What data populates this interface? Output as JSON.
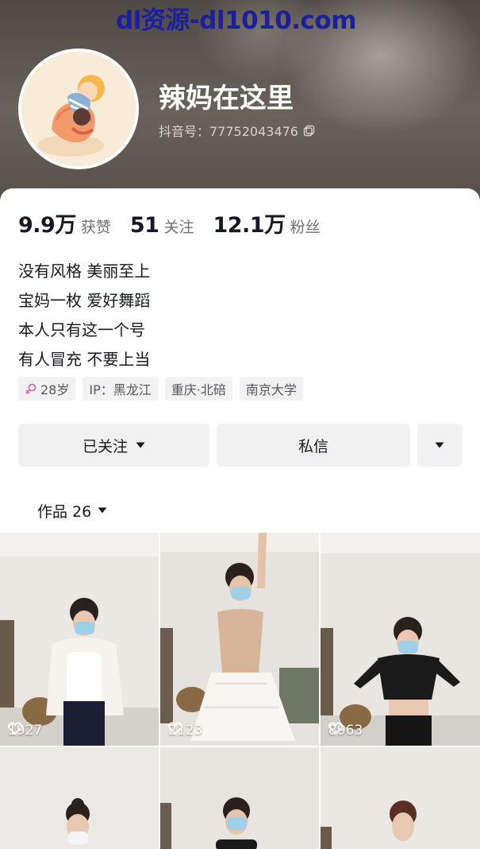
{
  "watermark": "dl资源-dl1010.com",
  "profile": {
    "nickname": "辣妈在这里",
    "douyin_id_label": "抖音号：77752043476",
    "avatar_icon": "avatar-illustration"
  },
  "stats": [
    {
      "value": "9.9万",
      "label": "获赞"
    },
    {
      "value": "51",
      "label": "关注"
    },
    {
      "value": "12.1万",
      "label": "粉丝"
    }
  ],
  "bio": [
    "没有风格 美丽至上",
    "宝妈一枚 爱好舞蹈",
    "本人只有这一个号",
    "有人冒充 不要上当"
  ],
  "tags": {
    "age": "28岁",
    "ip": "IP：黑龙江",
    "location": "重庆·北碚",
    "school": "南京大学"
  },
  "actions": {
    "follow_label": "已关注",
    "message_label": "私信"
  },
  "works_tab": {
    "label": "作品 26"
  },
  "videos": [
    {
      "likes": "1927"
    },
    {
      "likes": "2123"
    },
    {
      "likes": "8963"
    },
    {
      "likes": ""
    },
    {
      "likes": ""
    },
    {
      "likes": ""
    }
  ],
  "colors": {
    "accent_pink": "#e066b8",
    "text_primary": "#161823",
    "text_secondary": "#6f7079",
    "button_bg": "#f1f1f2",
    "watermark": "#1d1f9a"
  }
}
